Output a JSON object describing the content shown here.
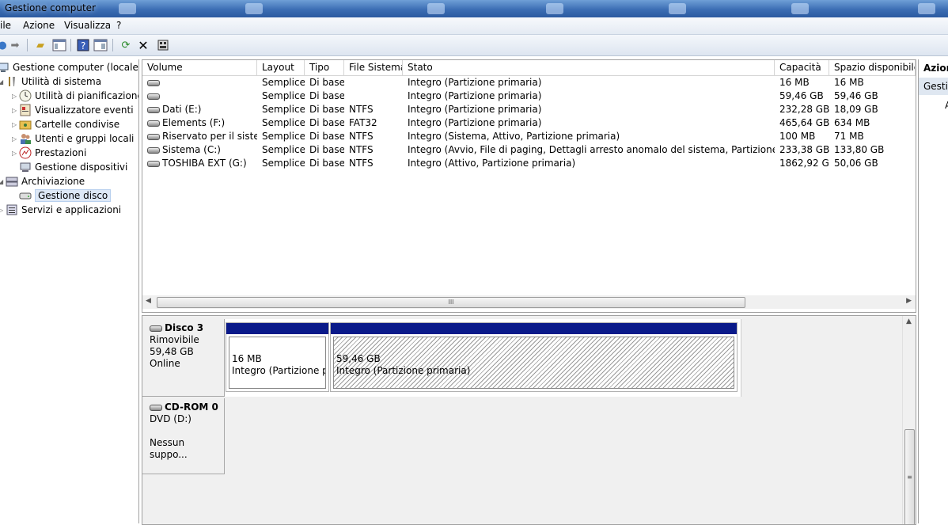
{
  "window": {
    "title": "Gestione computer"
  },
  "menu": [
    "ile",
    "Azione",
    "Visualizza",
    "?"
  ],
  "tree": {
    "root": "Gestione computer (locale)",
    "items": [
      "Utilità di sistema",
      "Utilità di pianificazione",
      "Visualizzatore eventi",
      "Cartelle condivise",
      "Utenti e gruppi locali",
      "Prestazioni",
      "Gestione dispositivi",
      "Archiviazione",
      "Gestione disco",
      "Servizi e applicazioni"
    ]
  },
  "volumes": {
    "headers": [
      "Volume",
      "Layout",
      "Tipo",
      "File Sistema",
      "Stato",
      "Capacità",
      "Spazio disponibile"
    ],
    "rows": [
      [
        "",
        "Semplice",
        "Di base",
        "",
        "Integro (Partizione primaria)",
        "16 MB",
        "16 MB"
      ],
      [
        "",
        "Semplice",
        "Di base",
        "",
        "Integro (Partizione primaria)",
        "59,46 GB",
        "59,46 GB"
      ],
      [
        "Dati (E:)",
        "Semplice",
        "Di base",
        "NTFS",
        "Integro (Partizione primaria)",
        "232,28 GB",
        "18,09 GB"
      ],
      [
        "Elements (F:)",
        "Semplice",
        "Di base",
        "FAT32",
        "Integro (Partizione primaria)",
        "465,64 GB",
        "634 MB"
      ],
      [
        "Riservato per il sistema",
        "Semplice",
        "Di base",
        "NTFS",
        "Integro (Sistema, Attivo, Partizione primaria)",
        "100 MB",
        "71 MB"
      ],
      [
        "Sistema (C:)",
        "Semplice",
        "Di base",
        "NTFS",
        "Integro (Avvio, File di paging, Dettagli arresto anomalo del sistema, Partizione primaria)",
        "233,38 GB",
        "133,80 GB"
      ],
      [
        "TOSHIBA EXT (G:)",
        "Semplice",
        "Di base",
        "NTFS",
        "Integro (Attivo, Partizione primaria)",
        "1862,92 GB",
        "50,06 GB"
      ]
    ],
    "scroll_glyph": "III"
  },
  "disks": [
    {
      "name": "Disco 3",
      "type": "Rimovibile",
      "size": "59,48 GB",
      "status": "Online",
      "partitions": [
        {
          "size": "16 MB",
          "status": "Integro (Partizione pri"
        },
        {
          "size": "59,46 GB",
          "status": "Integro (Partizione primaria)"
        }
      ]
    },
    {
      "name": "CD-ROM 0",
      "type": "DVD (D:)",
      "status": "Nessun suppo..."
    }
  ],
  "actions_panel": {
    "header": "Azion",
    "item": "Gestio",
    "sub": "A"
  },
  "colors": {
    "partition_bar": "#0a1a8a",
    "selection": "#dde8f6"
  }
}
